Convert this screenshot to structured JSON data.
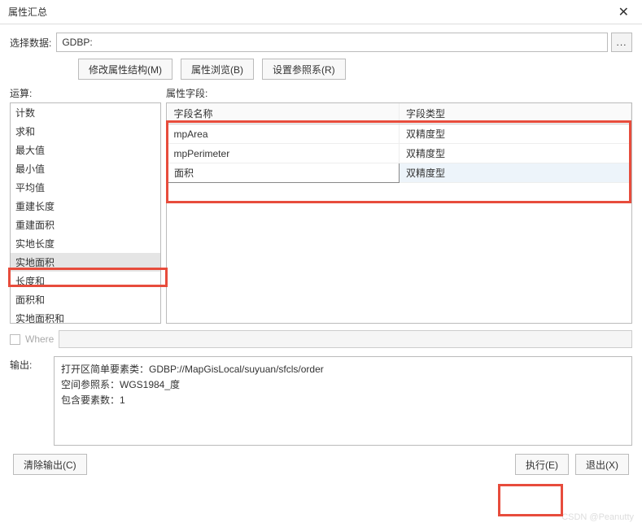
{
  "window": {
    "title": "属性汇总",
    "close": "✕"
  },
  "selectData": {
    "label": "选择数据:",
    "value": "GDBP:",
    "browse": "..."
  },
  "buttons": {
    "modify": "修改属性结构(M)",
    "browse": "属性浏览(B)",
    "setRef": "设置参照系(R)",
    "clear": "清除输出(C)",
    "exec": "执行(E)",
    "exit": "退出(X)"
  },
  "operation": {
    "label": "运算:",
    "items": [
      "计数",
      "求和",
      "最大值",
      "最小值",
      "平均值",
      "重建长度",
      "重建面积",
      "实地长度",
      "实地面积",
      "长度和",
      "面积和",
      "实地面积和"
    ],
    "selected": "实地面积"
  },
  "fields": {
    "label": "属性字段:",
    "cols": [
      "字段名称",
      "字段类型"
    ],
    "rows": [
      {
        "name": "mpArea",
        "type": "双精度型"
      },
      {
        "name": "mpPerimeter",
        "type": "双精度型"
      },
      {
        "name": "面积",
        "type": "双精度型"
      }
    ],
    "selectedIndex": 2
  },
  "where": {
    "label": "Where"
  },
  "output": {
    "label": "输出:",
    "text": "打开区简单要素类：GDBP://MapGisLocal/suyuan/sfcls/order\n空间参照系：WGS1984_度\n包含要素数：1"
  },
  "watermark": "CSDN @Peanutty"
}
